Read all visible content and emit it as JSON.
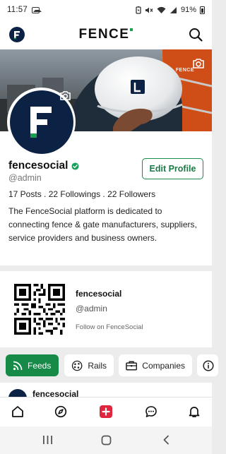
{
  "status_bar": {
    "time": "11:57",
    "battery": "91%",
    "icons": [
      "image-icon",
      "battery-saver-icon",
      "mute-icon",
      "wifi-icon",
      "signal-icon",
      "battery-icon"
    ]
  },
  "header": {
    "brand": "FENCE",
    "avatar_icon": "fence-logo-icon",
    "search_icon": "search-icon"
  },
  "cover": {
    "watermark": "FENCE",
    "camera_icon": "camera-icon"
  },
  "profile": {
    "name": "fencesocial",
    "handle": "@admin",
    "verified_icon": "verified-check-icon",
    "edit_label": "Edit Profile",
    "stats": "17 Posts . 22 Followings . 22 Followers",
    "bio": "The FenceSocial platform is dedicated to connecting fence & gate manufacturers, suppliers, service providers and business owners."
  },
  "qr_card": {
    "name": "fencesocial",
    "handle": "@admin",
    "follow_text": "Follow on FenceSocial"
  },
  "tabs": [
    {
      "label": "Feeds",
      "icon": "rss-icon",
      "active": true
    },
    {
      "label": "Rails",
      "icon": "rails-icon",
      "active": false
    },
    {
      "label": "Companies",
      "icon": "briefcase-icon",
      "active": false
    },
    {
      "label": "",
      "icon": "info-icon",
      "active": false
    }
  ],
  "feed_peek": {
    "name": "fencesocial"
  },
  "bottom_nav": [
    {
      "icon": "home-icon"
    },
    {
      "icon": "compass-icon"
    },
    {
      "icon": "add-icon"
    },
    {
      "icon": "chat-icon"
    },
    {
      "icon": "bell-icon"
    }
  ],
  "colors": {
    "brand_green": "#178a48",
    "brand_navy": "#0b2245",
    "add_red": "#e0263e"
  }
}
